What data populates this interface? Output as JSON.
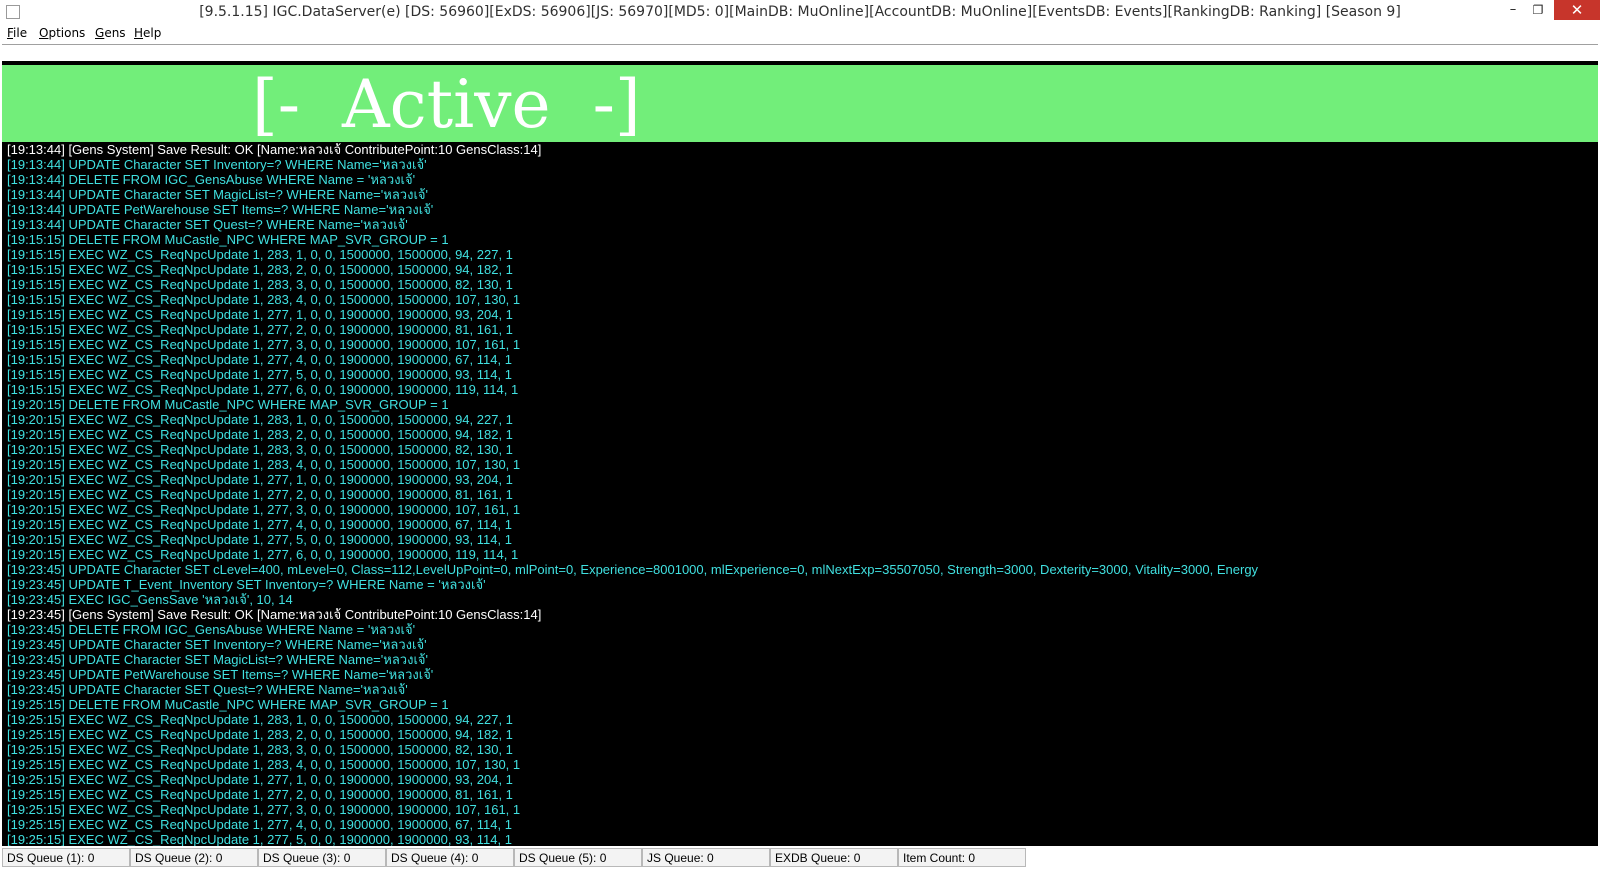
{
  "window": {
    "title": "[9.5.1.15] IGC.DataServer(e) [DS: 56960][ExDS: 56906][JS: 56970][MD5: 0][MainDB: MuOnline][AccountDB: MuOnline][EventsDB: Events][RankingDB: Ranking] [Season 9]",
    "controls": {
      "minimize": "–",
      "maximize": "❐",
      "close": "✕"
    }
  },
  "menu": [
    {
      "acc": "F",
      "rest": "ile"
    },
    {
      "acc": "O",
      "rest": "ptions"
    },
    {
      "acc": "G",
      "rest": "ens"
    },
    {
      "acc": "H",
      "rest": "elp"
    }
  ],
  "status_banner": {
    "text": "[-  Active  -]",
    "color": "#72ee7a"
  },
  "colors": {
    "log_text": "#40e0e0",
    "gens_text": "#ffffff",
    "log_bg": "#000000"
  },
  "log_lines": [
    {
      "text": "[19:13:44] [Gens System] Save Result: OK [Name:หลวงเจ้ ContributePoint:10 GensClass:14]",
      "type": "gens"
    },
    {
      "text": "[19:13:44] UPDATE Character SET Inventory=? WHERE Name='หลวงเจ้'",
      "type": "sql"
    },
    {
      "text": "[19:13:44] DELETE FROM IGC_GensAbuse WHERE Name = 'หลวงเจ้'",
      "type": "sql"
    },
    {
      "text": "[19:13:44] UPDATE Character SET MagicList=? WHERE Name='หลวงเจ้'",
      "type": "sql"
    },
    {
      "text": "[19:13:44] UPDATE PetWarehouse SET Items=? WHERE Name='หลวงเจ้'",
      "type": "sql"
    },
    {
      "text": "[19:13:44] UPDATE Character SET Quest=? WHERE Name='หลวงเจ้'",
      "type": "sql"
    },
    {
      "text": "[19:15:15] DELETE FROM MuCastle_NPC WHERE MAP_SVR_GROUP = 1",
      "type": "sql"
    },
    {
      "text": "[19:15:15] EXEC WZ_CS_ReqNpcUpdate 1, 283, 1, 0, 0, 1500000, 1500000, 94, 227, 1",
      "type": "sql"
    },
    {
      "text": "[19:15:15] EXEC WZ_CS_ReqNpcUpdate 1, 283, 2, 0, 0, 1500000, 1500000, 94, 182, 1",
      "type": "sql"
    },
    {
      "text": "[19:15:15] EXEC WZ_CS_ReqNpcUpdate 1, 283, 3, 0, 0, 1500000, 1500000, 82, 130, 1",
      "type": "sql"
    },
    {
      "text": "[19:15:15] EXEC WZ_CS_ReqNpcUpdate 1, 283, 4, 0, 0, 1500000, 1500000, 107, 130, 1",
      "type": "sql"
    },
    {
      "text": "[19:15:15] EXEC WZ_CS_ReqNpcUpdate 1, 277, 1, 0, 0, 1900000, 1900000, 93, 204, 1",
      "type": "sql"
    },
    {
      "text": "[19:15:15] EXEC WZ_CS_ReqNpcUpdate 1, 277, 2, 0, 0, 1900000, 1900000, 81, 161, 1",
      "type": "sql"
    },
    {
      "text": "[19:15:15] EXEC WZ_CS_ReqNpcUpdate 1, 277, 3, 0, 0, 1900000, 1900000, 107, 161, 1",
      "type": "sql"
    },
    {
      "text": "[19:15:15] EXEC WZ_CS_ReqNpcUpdate 1, 277, 4, 0, 0, 1900000, 1900000, 67, 114, 1",
      "type": "sql"
    },
    {
      "text": "[19:15:15] EXEC WZ_CS_ReqNpcUpdate 1, 277, 5, 0, 0, 1900000, 1900000, 93, 114, 1",
      "type": "sql"
    },
    {
      "text": "[19:15:15] EXEC WZ_CS_ReqNpcUpdate 1, 277, 6, 0, 0, 1900000, 1900000, 119, 114, 1",
      "type": "sql"
    },
    {
      "text": "[19:20:15] DELETE FROM MuCastle_NPC WHERE MAP_SVR_GROUP = 1",
      "type": "sql"
    },
    {
      "text": "[19:20:15] EXEC WZ_CS_ReqNpcUpdate 1, 283, 1, 0, 0, 1500000, 1500000, 94, 227, 1",
      "type": "sql"
    },
    {
      "text": "[19:20:15] EXEC WZ_CS_ReqNpcUpdate 1, 283, 2, 0, 0, 1500000, 1500000, 94, 182, 1",
      "type": "sql"
    },
    {
      "text": "[19:20:15] EXEC WZ_CS_ReqNpcUpdate 1, 283, 3, 0, 0, 1500000, 1500000, 82, 130, 1",
      "type": "sql"
    },
    {
      "text": "[19:20:15] EXEC WZ_CS_ReqNpcUpdate 1, 283, 4, 0, 0, 1500000, 1500000, 107, 130, 1",
      "type": "sql"
    },
    {
      "text": "[19:20:15] EXEC WZ_CS_ReqNpcUpdate 1, 277, 1, 0, 0, 1900000, 1900000, 93, 204, 1",
      "type": "sql"
    },
    {
      "text": "[19:20:15] EXEC WZ_CS_ReqNpcUpdate 1, 277, 2, 0, 0, 1900000, 1900000, 81, 161, 1",
      "type": "sql"
    },
    {
      "text": "[19:20:15] EXEC WZ_CS_ReqNpcUpdate 1, 277, 3, 0, 0, 1900000, 1900000, 107, 161, 1",
      "type": "sql"
    },
    {
      "text": "[19:20:15] EXEC WZ_CS_ReqNpcUpdate 1, 277, 4, 0, 0, 1900000, 1900000, 67, 114, 1",
      "type": "sql"
    },
    {
      "text": "[19:20:15] EXEC WZ_CS_ReqNpcUpdate 1, 277, 5, 0, 0, 1900000, 1900000, 93, 114, 1",
      "type": "sql"
    },
    {
      "text": "[19:20:15] EXEC WZ_CS_ReqNpcUpdate 1, 277, 6, 0, 0, 1900000, 1900000, 119, 114, 1",
      "type": "sql"
    },
    {
      "text": "[19:23:45] UPDATE Character SET cLevel=400, mLevel=0, Class=112,LevelUpPoint=0, mlPoint=0, Experience=8001000, mlExperience=0, mlNextExp=35507050, Strength=3000, Dexterity=3000, Vitality=3000, Energy",
      "type": "sql"
    },
    {
      "text": "[19:23:45] UPDATE T_Event_Inventory SET Inventory=? WHERE Name = 'หลวงเจ้'",
      "type": "sql"
    },
    {
      "text": "[19:23:45] EXEC IGC_GensSave 'หลวงเจ้', 10, 14",
      "type": "sql"
    },
    {
      "text": "[19:23:45] [Gens System] Save Result: OK [Name:หลวงเจ้ ContributePoint:10 GensClass:14]",
      "type": "gens"
    },
    {
      "text": "[19:23:45] DELETE FROM IGC_GensAbuse WHERE Name = 'หลวงเจ้'",
      "type": "sql"
    },
    {
      "text": "[19:23:45] UPDATE Character SET Inventory=? WHERE Name='หลวงเจ้'",
      "type": "sql"
    },
    {
      "text": "[19:23:45] UPDATE Character SET MagicList=? WHERE Name='หลวงเจ้'",
      "type": "sql"
    },
    {
      "text": "[19:23:45] UPDATE PetWarehouse SET Items=? WHERE Name='หลวงเจ้'",
      "type": "sql"
    },
    {
      "text": "[19:23:45] UPDATE Character SET Quest=? WHERE Name='หลวงเจ้'",
      "type": "sql"
    },
    {
      "text": "[19:25:15] DELETE FROM MuCastle_NPC WHERE MAP_SVR_GROUP = 1",
      "type": "sql"
    },
    {
      "text": "[19:25:15] EXEC WZ_CS_ReqNpcUpdate 1, 283, 1, 0, 0, 1500000, 1500000, 94, 227, 1",
      "type": "sql"
    },
    {
      "text": "[19:25:15] EXEC WZ_CS_ReqNpcUpdate 1, 283, 2, 0, 0, 1500000, 1500000, 94, 182, 1",
      "type": "sql"
    },
    {
      "text": "[19:25:15] EXEC WZ_CS_ReqNpcUpdate 1, 283, 3, 0, 0, 1500000, 1500000, 82, 130, 1",
      "type": "sql"
    },
    {
      "text": "[19:25:15] EXEC WZ_CS_ReqNpcUpdate 1, 283, 4, 0, 0, 1500000, 1500000, 107, 130, 1",
      "type": "sql"
    },
    {
      "text": "[19:25:15] EXEC WZ_CS_ReqNpcUpdate 1, 277, 1, 0, 0, 1900000, 1900000, 93, 204, 1",
      "type": "sql"
    },
    {
      "text": "[19:25:15] EXEC WZ_CS_ReqNpcUpdate 1, 277, 2, 0, 0, 1900000, 1900000, 81, 161, 1",
      "type": "sql"
    },
    {
      "text": "[19:25:15] EXEC WZ_CS_ReqNpcUpdate 1, 277, 3, 0, 0, 1900000, 1900000, 107, 161, 1",
      "type": "sql"
    },
    {
      "text": "[19:25:15] EXEC WZ_CS_ReqNpcUpdate 1, 277, 4, 0, 0, 1900000, 1900000, 67, 114, 1",
      "type": "sql"
    },
    {
      "text": "[19:25:15] EXEC WZ_CS_ReqNpcUpdate 1, 277, 5, 0, 0, 1900000, 1900000, 93, 114, 1",
      "type": "sql"
    }
  ],
  "status_bar": [
    "DS Queue (1): 0",
    "DS Queue (2): 0",
    "DS Queue (3): 0",
    "DS Queue (4): 0",
    "DS Queue (5): 0",
    "JS Queue: 0",
    "EXDB Queue: 0",
    "Item Count: 0"
  ]
}
